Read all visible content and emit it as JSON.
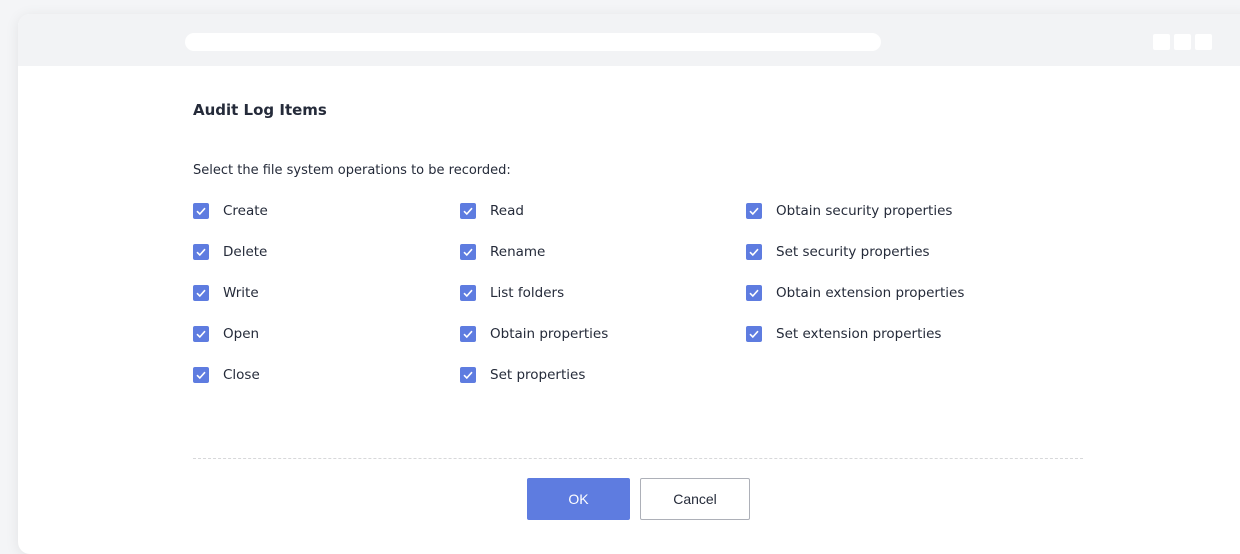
{
  "dialog": {
    "title": "Audit Log Items",
    "instruction": "Select the file system operations to be recorded:"
  },
  "options": {
    "col1": [
      {
        "label": "Create",
        "checked": true
      },
      {
        "label": "Delete",
        "checked": true
      },
      {
        "label": "Write",
        "checked": true
      },
      {
        "label": "Open",
        "checked": true
      },
      {
        "label": "Close",
        "checked": true
      }
    ],
    "col2": [
      {
        "label": "Read",
        "checked": true
      },
      {
        "label": "Rename",
        "checked": true
      },
      {
        "label": "List folders",
        "checked": true
      },
      {
        "label": "Obtain properties",
        "checked": true
      },
      {
        "label": "Set properties",
        "checked": true
      }
    ],
    "col3": [
      {
        "label": "Obtain security properties",
        "checked": true
      },
      {
        "label": "Set security properties",
        "checked": true
      },
      {
        "label": "Obtain extension properties",
        "checked": true
      },
      {
        "label": "Set extension properties",
        "checked": true
      }
    ]
  },
  "footer": {
    "ok_label": "OK",
    "cancel_label": "Cancel"
  },
  "colors": {
    "accent": "#5e7ce0",
    "text": "#252b3a",
    "divider": "#d7d8da"
  },
  "icons": {
    "checkbox": "checkmark-icon"
  }
}
